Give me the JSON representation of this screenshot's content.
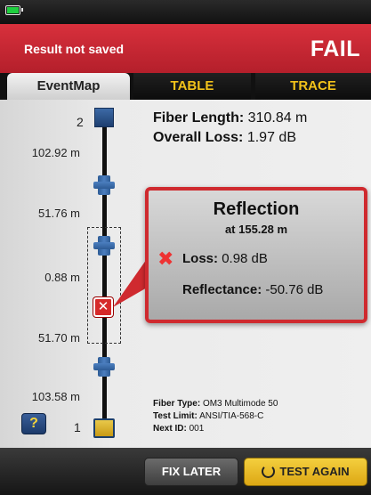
{
  "status_bar": {
    "battery_icon": "battery-icon",
    "battery_color": "#1fcf3f"
  },
  "result": {
    "message": "Result not saved",
    "status": "FAIL",
    "color": "#cf2a2f"
  },
  "tabs": [
    {
      "label": "EventMap",
      "active": true
    },
    {
      "label": "TABLE",
      "active": false
    },
    {
      "label": "TRACE",
      "active": false
    }
  ],
  "event_map": {
    "top_end_number": "2",
    "bottom_end_number": "1",
    "distances": [
      "102.92 m",
      "51.76 m",
      "0.88 m",
      "51.70 m",
      "103.58 m"
    ],
    "help_label": "?"
  },
  "summary": {
    "fiber_length_label": "Fiber Length:",
    "fiber_length_value": "310.84 m",
    "overall_loss_label": "Overall Loss:",
    "overall_loss_value": "1.97 dB"
  },
  "popup": {
    "title": "Reflection",
    "subtitle": "at 155.28 m",
    "loss_label": "Loss:",
    "loss_value": "0.98 dB",
    "reflectance_label": "Reflectance:",
    "reflectance_value": "-50.76 dB"
  },
  "info": {
    "fiber_type_label": "Fiber Type:",
    "fiber_type_value": "OM3 Multimode 50",
    "test_limit_label": "Test Limit:",
    "test_limit_value": "ANSI/TIA-568-C",
    "next_id_label": "Next ID:",
    "next_id_value": "001"
  },
  "buttons": {
    "fix_later": "FIX LATER",
    "test_again": "TEST AGAIN"
  }
}
